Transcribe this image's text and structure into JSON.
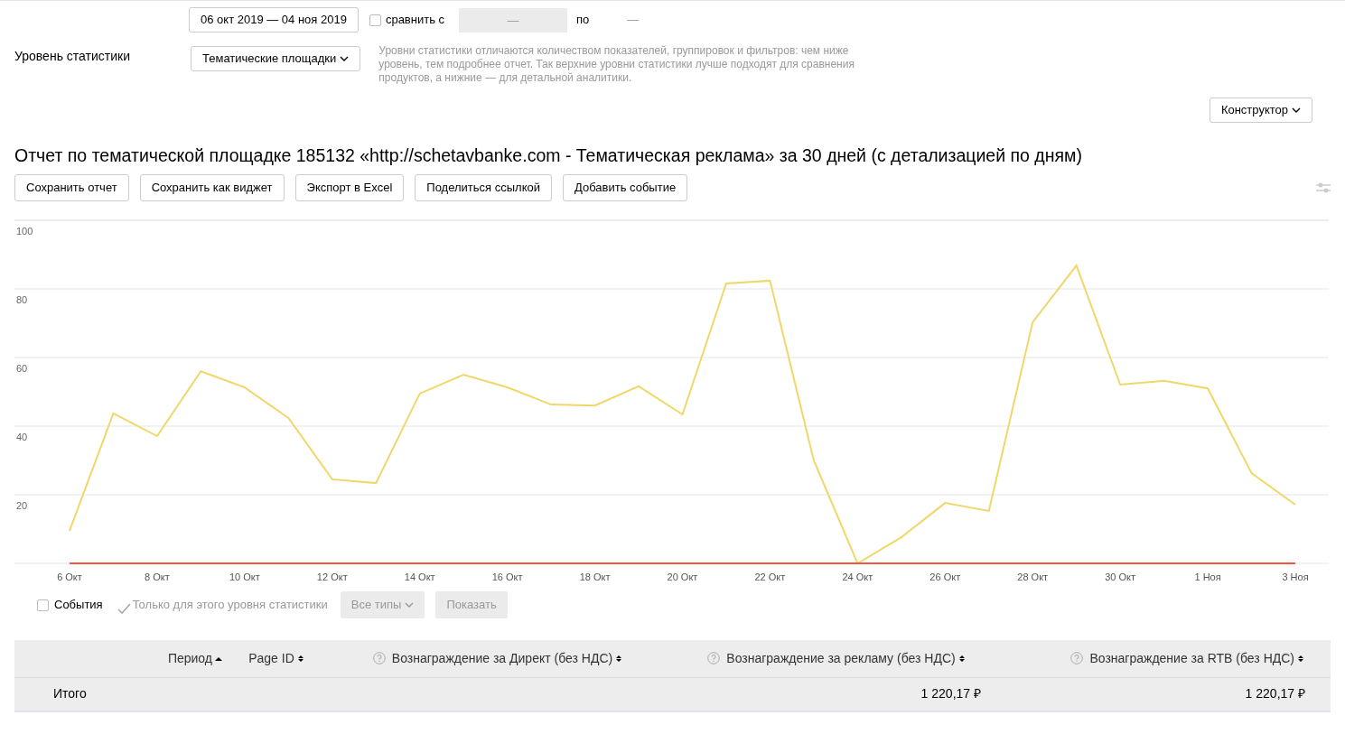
{
  "period": {
    "range": "06 окт 2019 — 04 ноя 2019",
    "compare": {
      "label": "сравнить с",
      "checked": false,
      "from": "—",
      "to_label": "по",
      "to": "—"
    }
  },
  "level": {
    "label": "Уровень статистики",
    "value": "Тематические площадки",
    "hint": "Уровни статистики отличаются количеством показателей, группировок и фильтров: чем ниже уровень, тем подробнее отчет. Так верхние уровни статистики лучше подходят для сравнения продуктов, а нижние — для детальной аналитики."
  },
  "constructor_button": "Конструктор",
  "report": {
    "title": "Отчет по тематической площадке 185132 «http://schetavbanke.com - Тематическая реклама» за 30 дней (с детализацией по дням)",
    "buttons": [
      "Сохранить отчет",
      "Сохранить как виджет",
      "Экспорт в Excel",
      "Поделиться ссылкой",
      "Добавить событие"
    ]
  },
  "chart_data": {
    "type": "line",
    "categories": [
      "6 Окт",
      null,
      "8 Окт",
      null,
      "10 Окт",
      null,
      "12 Окт",
      null,
      "14 Окт",
      null,
      "16 Окт",
      null,
      "18 Окт",
      null,
      "20 Окт",
      null,
      "22 Окт",
      null,
      "24 Окт",
      null,
      "26 Окт",
      null,
      "28 Окт",
      null,
      "30 Окт",
      null,
      "1 Ноя",
      null,
      "3 Ноя"
    ],
    "series": [
      {
        "color": "#f0d76a",
        "values": [
          9.5,
          43.7,
          37.1,
          56,
          51.3,
          42.4,
          24.5,
          23.4,
          49.5,
          55,
          51.3,
          46.3,
          46,
          51.6,
          43.4,
          81.6,
          82.4,
          30,
          0,
          7.6,
          17.6,
          15.3,
          70.3,
          86.8,
          52.1,
          53.2,
          51,
          26.3,
          17.1
        ]
      },
      {
        "color": "#f0573c",
        "values": [
          0,
          0,
          0,
          0,
          0,
          0,
          0,
          0,
          0,
          0,
          0,
          0,
          0,
          0,
          0,
          0,
          0,
          0,
          0,
          0,
          0,
          0,
          0,
          0,
          0,
          0,
          0,
          0,
          0
        ]
      }
    ],
    "ylim": [
      0,
      100
    ],
    "grid": true,
    "yticks": [
      20,
      40,
      60,
      80,
      100
    ]
  },
  "events": {
    "events_checkbox": {
      "label": "События",
      "checked": false
    },
    "level_only": {
      "label": "Только для этого уровня статистики",
      "checked": true,
      "disabled": true
    },
    "types": "Все типы",
    "show": "Показать"
  },
  "table": {
    "columns": [
      {
        "label": "Период",
        "sorted": true,
        "help": false
      },
      {
        "label": "Page ID",
        "sorted": false,
        "help": false
      },
      {
        "label": "Вознаграждение за Директ (без НДС)",
        "sorted": false,
        "help": true
      },
      {
        "label": "Вознаграждение за рекламу (без НДС)",
        "sorted": false,
        "help": true
      },
      {
        "label": "Вознаграждение за RTB (без НДС)",
        "sorted": false,
        "help": true
      }
    ],
    "total": {
      "label": "Итого",
      "values": [
        "1 220,17 ₽",
        "1 220,17 ₽"
      ]
    }
  }
}
